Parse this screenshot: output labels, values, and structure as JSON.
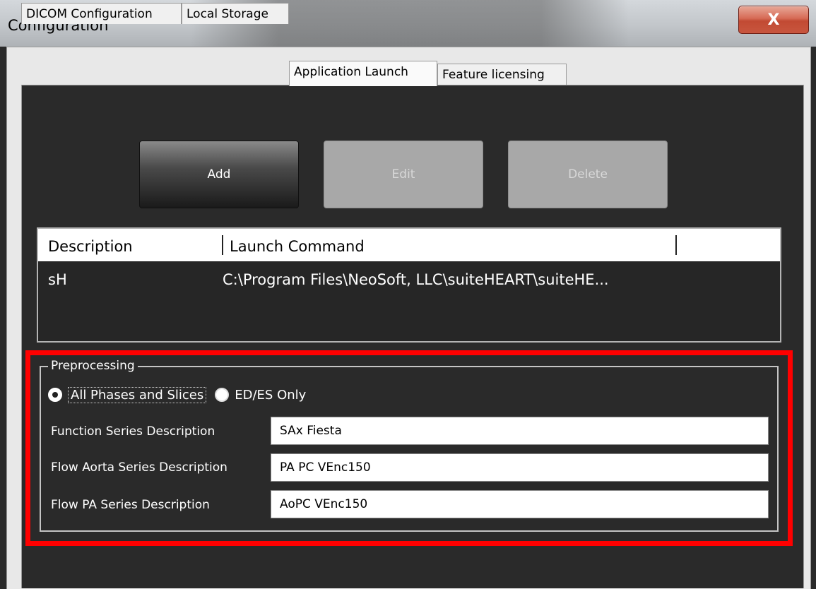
{
  "window": {
    "title": "Configuration",
    "close_label": "X"
  },
  "tabs": [
    {
      "label": "DICOM Configuration"
    },
    {
      "label": "Local Storage"
    },
    {
      "label": "Application Launch"
    },
    {
      "label": "Feature licensing"
    }
  ],
  "active_tab": "Application Launch",
  "toolbar": {
    "add_label": "Add",
    "edit_label": "Edit",
    "delete_label": "Delete"
  },
  "list": {
    "columns": [
      "Description",
      "Launch Command"
    ],
    "rows": [
      {
        "description": "sH",
        "command": "C:\\Program Files\\NeoSoft, LLC\\suiteHEART\\suiteHE..."
      }
    ]
  },
  "preprocessing": {
    "legend": "Preprocessing",
    "options": [
      {
        "label": "All Phases and Slices",
        "selected": true
      },
      {
        "label": "ED/ES Only",
        "selected": false
      }
    ],
    "fields": [
      {
        "label": "Function Series Description",
        "value": "SAx Fiesta"
      },
      {
        "label": "Flow Aorta Series Description",
        "value": "PA PC VEnc150"
      },
      {
        "label": "Flow PA Series Description",
        "value": "AoPC VEnc150"
      }
    ]
  },
  "colors": {
    "panel_background": "#2a2a2a",
    "highlight": "#ff0000",
    "close_button": "#c8563f"
  }
}
